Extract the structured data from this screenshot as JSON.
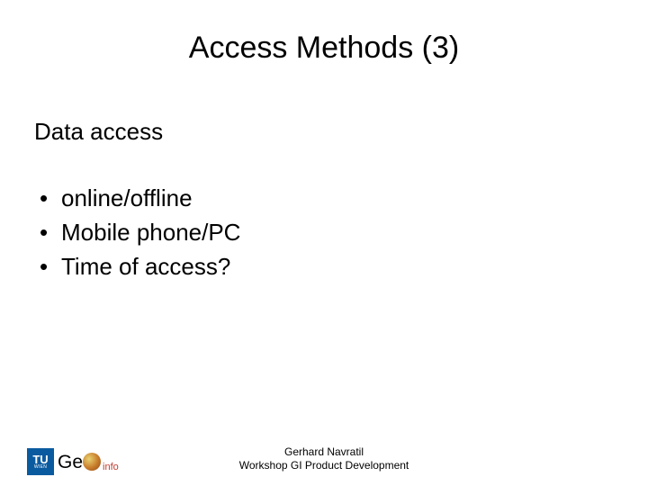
{
  "title": "Access Methods (3)",
  "subtitle": "Data access",
  "bullets": [
    "online/offline",
    "Mobile phone/PC",
    "Time of access?"
  ],
  "footer": {
    "author": "Gerhard Navratil",
    "event": "Workshop GI Product Development"
  },
  "logos": {
    "tu_top": "TU",
    "tu_bottom": "WIEN",
    "geo_text_main": "Ge",
    "geo_text_sub": "info"
  }
}
